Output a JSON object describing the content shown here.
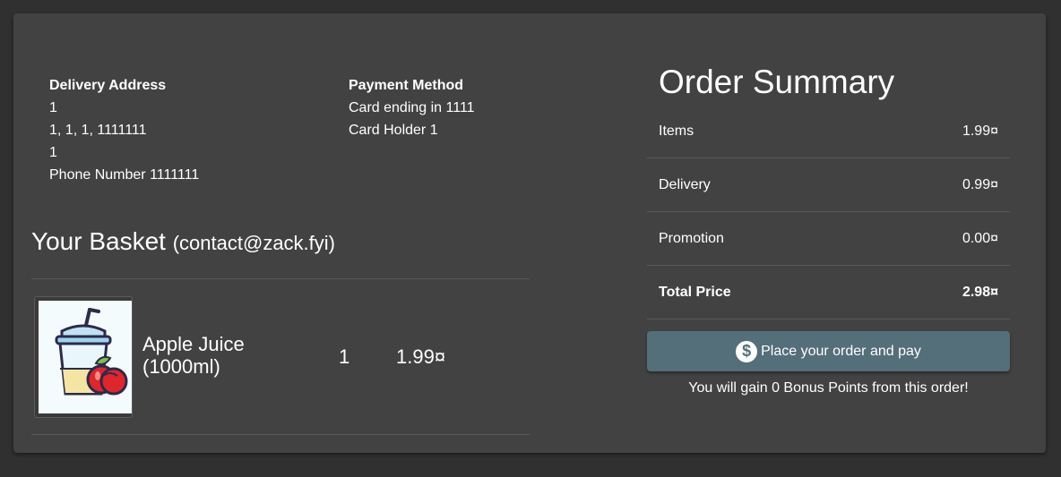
{
  "delivery": {
    "heading": "Delivery Address",
    "lines": [
      "1",
      "1, 1, 1, 1111111",
      "1",
      "Phone Number 1111111"
    ]
  },
  "payment": {
    "heading": "Payment Method",
    "lines": [
      "Card ending in 1111",
      "Card Holder 1"
    ]
  },
  "basket": {
    "title": "Your Basket",
    "email": "(contact@zack.fyi)",
    "items": [
      {
        "name": "Apple Juice (1000ml)",
        "quantity": "1",
        "price": "1.99¤",
        "image_icon": "apple-juice-icon"
      }
    ]
  },
  "summary": {
    "title": "Order Summary",
    "rows": [
      {
        "label": "Items",
        "value": "1.99¤"
      },
      {
        "label": "Delivery",
        "value": "0.99¤"
      },
      {
        "label": "Promotion",
        "value": "0.00¤"
      },
      {
        "label": "Total Price",
        "value": "2.98¤"
      }
    ],
    "button_label": "Place your order and pay",
    "button_icon": "dollar-icon",
    "bonus_text": "You will gain 0 Bonus Points from this order!"
  },
  "colors": {
    "page_bg": "#303030",
    "card_bg": "#424242",
    "button_bg": "#546e7a",
    "text": "#ffffff"
  }
}
